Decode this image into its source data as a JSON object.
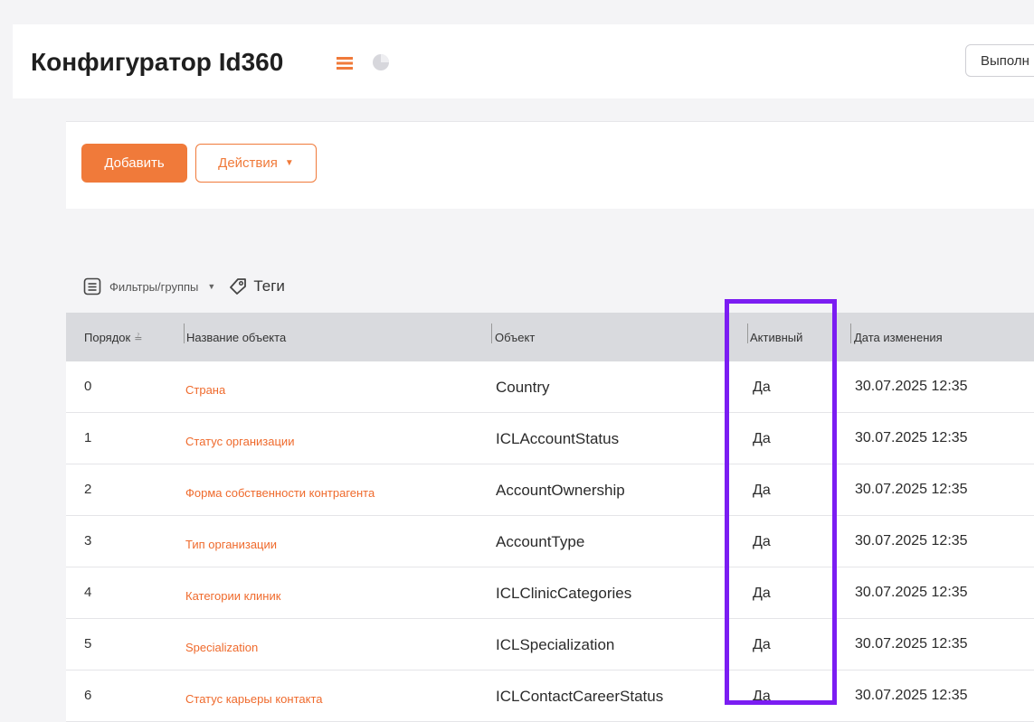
{
  "header": {
    "title": "Конфигуратор Id360",
    "run_button_label": "Выполн"
  },
  "toolbar": {
    "add_label": "Добавить",
    "actions_label": "Действия"
  },
  "filters": {
    "filters_label": "Фильтры/группы",
    "tags_label": "Теги"
  },
  "table": {
    "columns": [
      "Порядок",
      "Название объекта",
      "Объект",
      "Активный",
      "Дата изменения"
    ],
    "rows": [
      {
        "order": "0",
        "name": "Страна",
        "object": "Country",
        "active": "Да",
        "date": "30.07.2025 12:35"
      },
      {
        "order": "1",
        "name": "Статус организации",
        "object": "ICLAccountStatus",
        "active": "Да",
        "date": "30.07.2025 12:35"
      },
      {
        "order": "2",
        "name": "Форма собственности контрагента",
        "object": "AccountOwnership",
        "active": "Да",
        "date": "30.07.2025 12:35"
      },
      {
        "order": "3",
        "name": "Тип организации",
        "object": "AccountType",
        "active": "Да",
        "date": "30.07.2025 12:35"
      },
      {
        "order": "4",
        "name": "Категории клиник",
        "object": "ICLClinicCategories",
        "active": "Да",
        "date": "30.07.2025 12:35"
      },
      {
        "order": "5",
        "name": "Specialization",
        "object": "ICLSpecialization",
        "active": "Да",
        "date": "30.07.2025 12:35"
      },
      {
        "order": "6",
        "name": "Статус карьеры контакта",
        "object": "ICLContactCareerStatus",
        "active": "Да",
        "date": "30.07.2025 12:35"
      }
    ]
  },
  "colors": {
    "accent": "#f07a3a",
    "highlight": "#7b1df2",
    "header_bg": "#d9dade"
  },
  "icons": [
    "menu-icon",
    "pie-chart-icon",
    "filter-list-icon",
    "tag-icon",
    "sort-icon",
    "caret-down-icon"
  ]
}
